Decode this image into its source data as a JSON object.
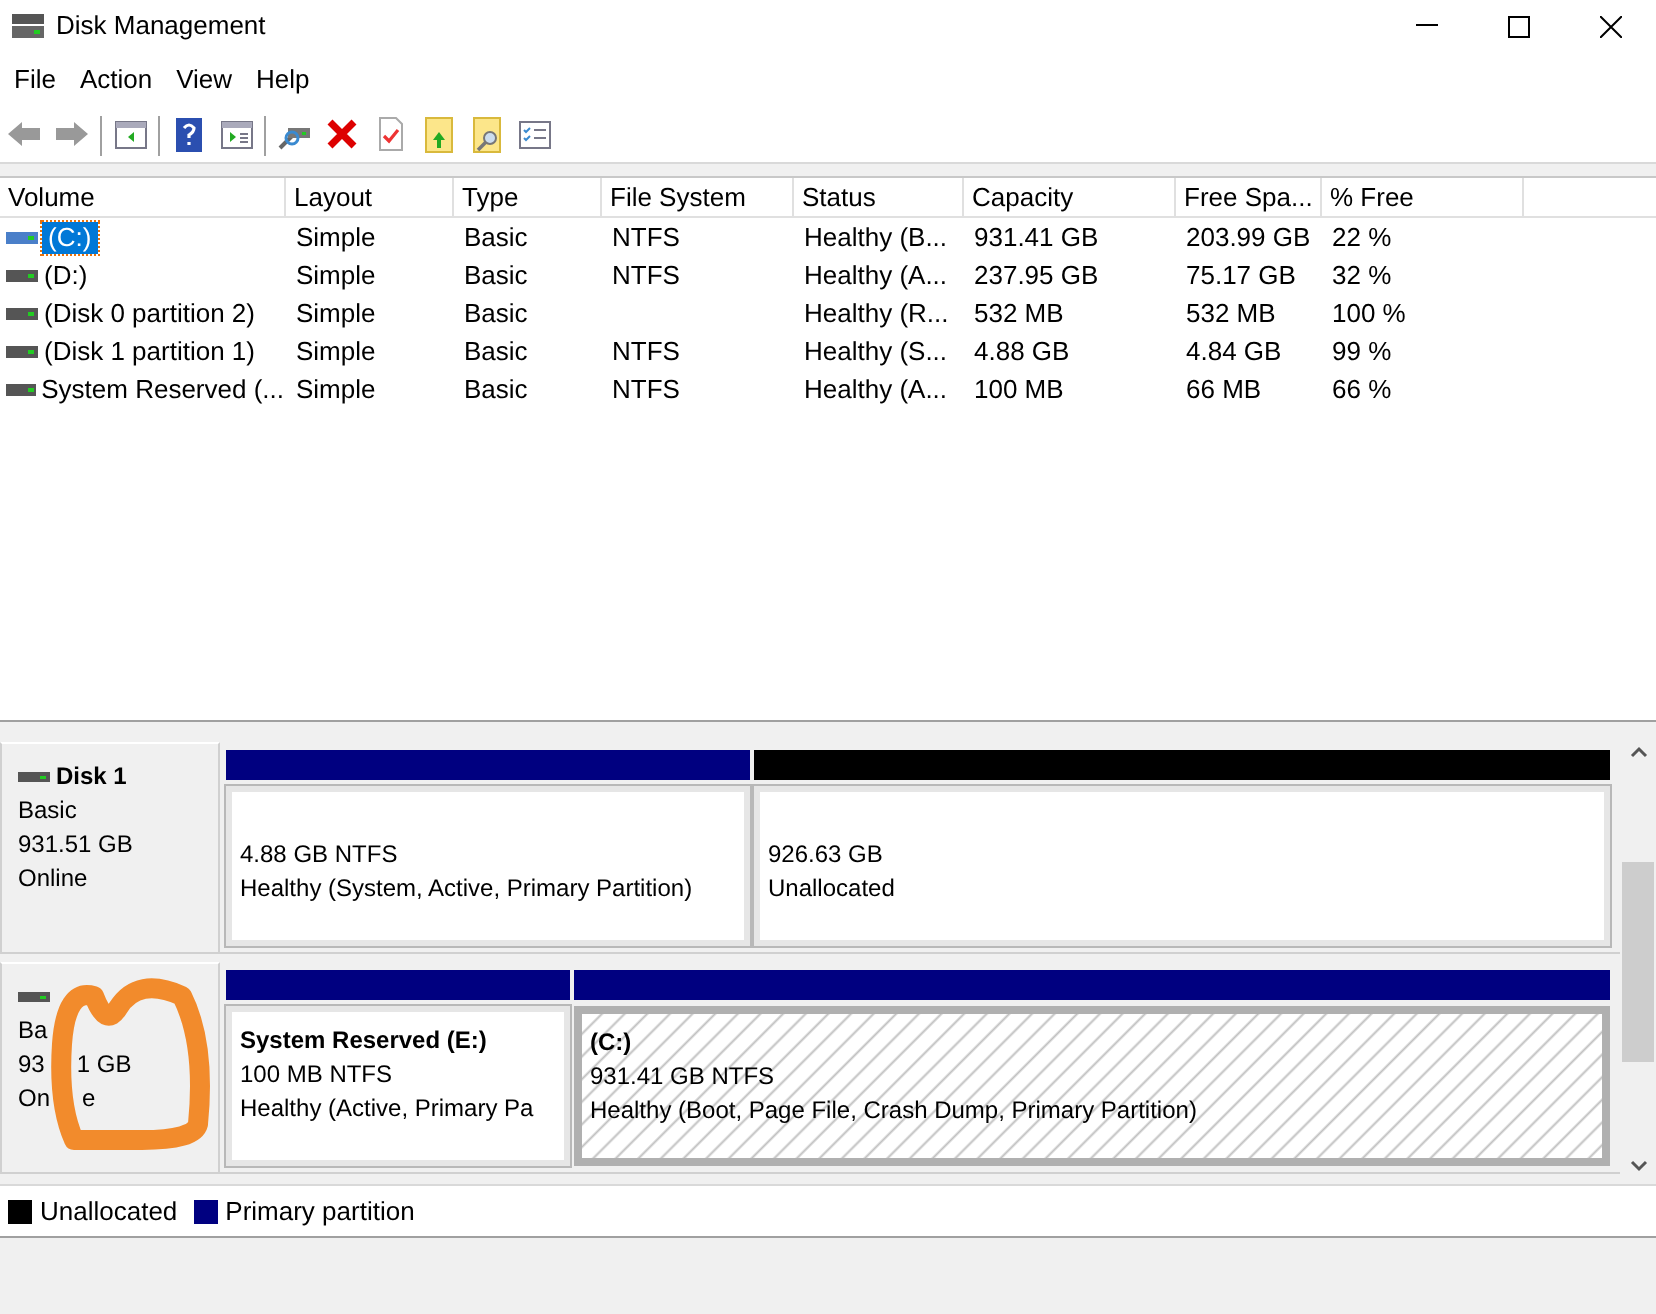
{
  "window": {
    "title": "Disk Management"
  },
  "menu": [
    "File",
    "Action",
    "View",
    "Help"
  ],
  "table": {
    "columns": [
      "Volume",
      "Layout",
      "Type",
      "File System",
      "Status",
      "Capacity",
      "Free Spa...",
      "% Free"
    ],
    "rows": [
      {
        "selected": true,
        "cells": [
          "(C:)",
          "Simple",
          "Basic",
          "NTFS",
          "Healthy (B...",
          "931.41 GB",
          "203.99 GB",
          "22 %"
        ]
      },
      {
        "selected": false,
        "cells": [
          "(D:)",
          "Simple",
          "Basic",
          "NTFS",
          "Healthy (A...",
          "237.95 GB",
          "75.17 GB",
          "32 %"
        ]
      },
      {
        "selected": false,
        "cells": [
          "(Disk 0 partition 2)",
          "Simple",
          "Basic",
          "",
          "Healthy (R...",
          "532 MB",
          "532 MB",
          "100 %"
        ]
      },
      {
        "selected": false,
        "cells": [
          "(Disk 1 partition 1)",
          "Simple",
          "Basic",
          "NTFS",
          "Healthy (S...",
          "4.88 GB",
          "4.84 GB",
          "99 %"
        ]
      },
      {
        "selected": false,
        "cells": [
          "System Reserved (...",
          "Simple",
          "Basic",
          "NTFS",
          "Healthy (A...",
          "100 MB",
          "66 MB",
          "66 %"
        ]
      }
    ]
  },
  "disks": [
    {
      "name": "Disk 1",
      "info": [
        [
          "Basic"
        ],
        [
          "931.51 GB"
        ],
        [
          "Online"
        ]
      ],
      "partitions": [
        {
          "kind": "primary",
          "selected": false,
          "lines": [
            "4.88 GB NTFS",
            "Healthy (System, Active, Primary Partition)"
          ]
        },
        {
          "kind": "unallocated",
          "selected": false,
          "lines": [
            "926.63 GB",
            "Unallocated"
          ]
        }
      ]
    },
    {
      "info": [
        [
          "Ba"
        ],
        [
          "93",
          "1 GB"
        ],
        [
          "On",
          "e"
        ]
      ],
      "scribbled": true,
      "partitions": [
        {
          "kind": "primary",
          "selected": false,
          "title": "System Reserved  (E:)",
          "lines": [
            "100 MB NTFS",
            "Healthy (Active, Primary Pa"
          ]
        },
        {
          "kind": "primary",
          "selected": true,
          "title": "(C:)",
          "lines": [
            "931.41 GB NTFS",
            "Healthy (Boot, Page File, Crash Dump, Primary Partition)"
          ]
        }
      ]
    }
  ],
  "legend": [
    {
      "label": "Unallocated",
      "color": "#000000"
    },
    {
      "label": "Primary partition",
      "color": "#000080"
    }
  ]
}
